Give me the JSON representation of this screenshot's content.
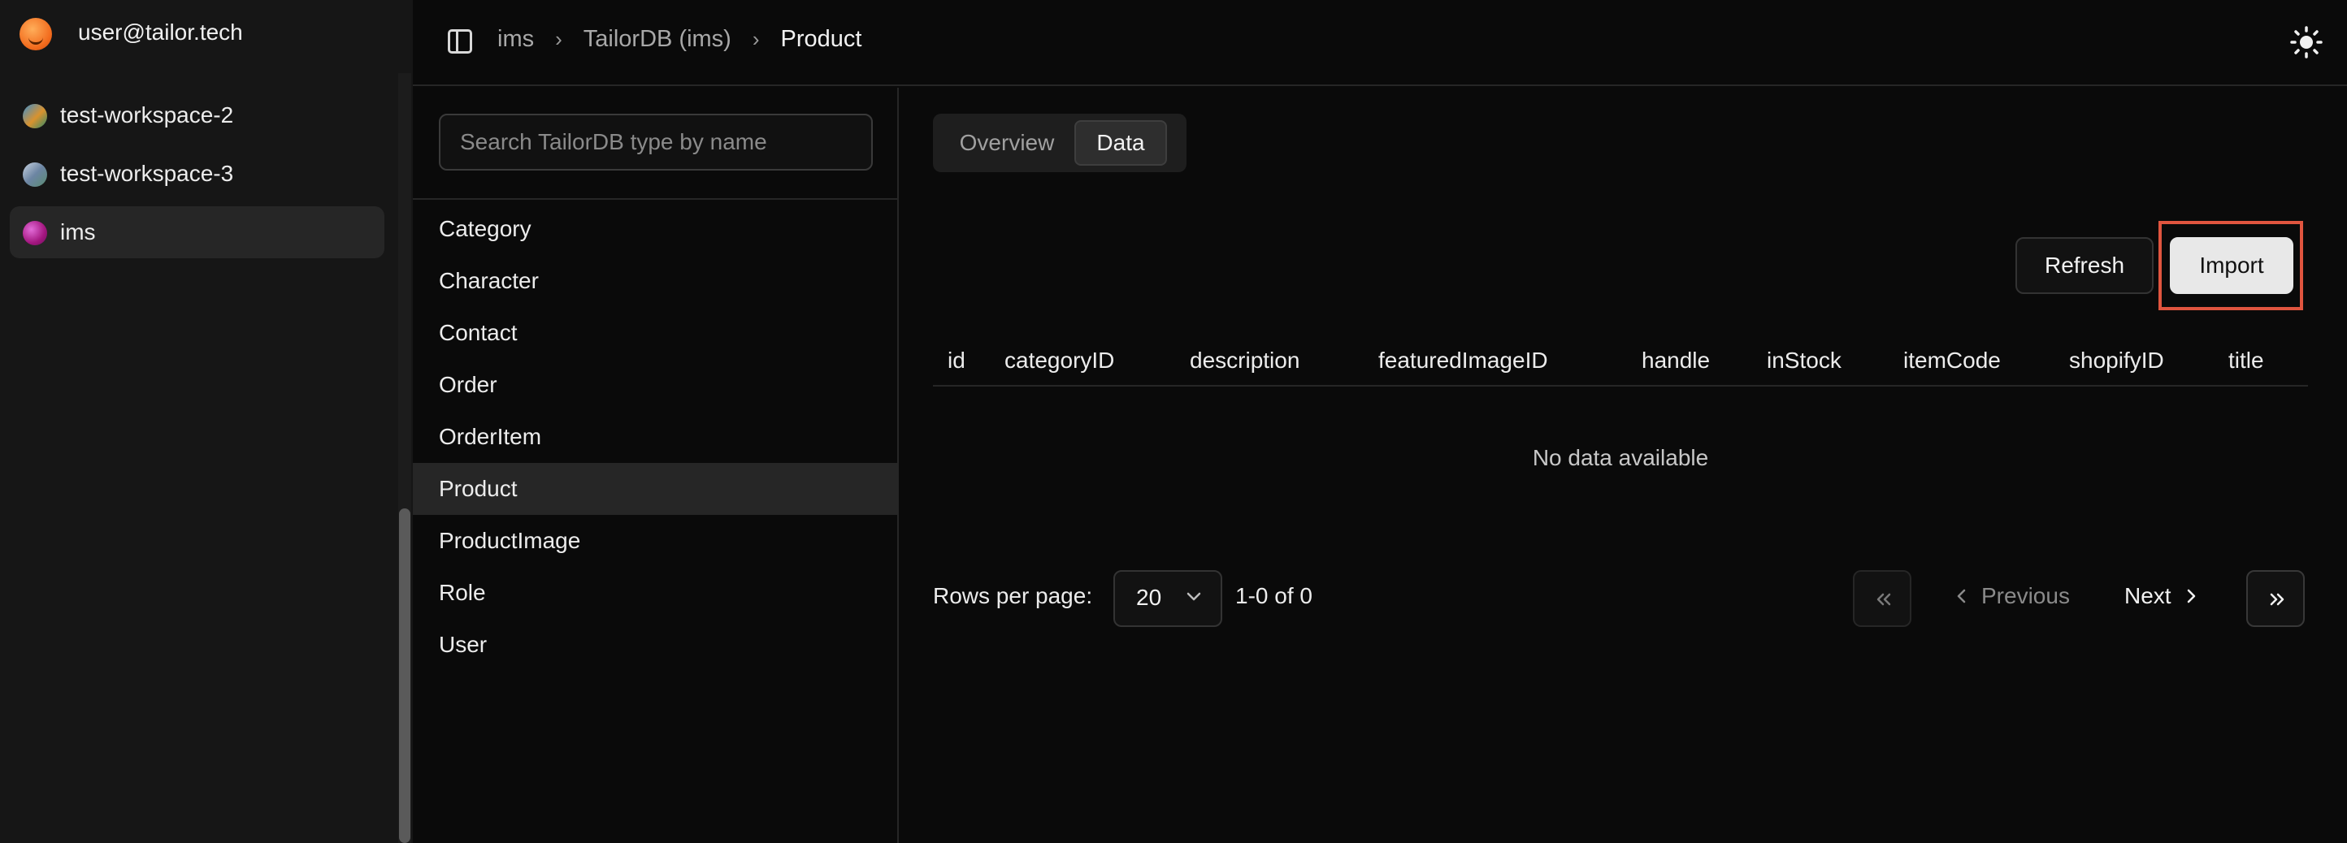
{
  "user": {
    "email": "user@tailor.tech"
  },
  "workspaces": [
    {
      "label": "test-workspace-2",
      "active": false
    },
    {
      "label": "test-workspace-3",
      "active": false
    },
    {
      "label": "ims",
      "active": true
    }
  ],
  "breadcrumb": [
    "ims",
    "TailorDB (ims)",
    "Product"
  ],
  "search": {
    "placeholder": "Search TailorDB type by name",
    "value": ""
  },
  "types": [
    "Category",
    "Character",
    "Contact",
    "Order",
    "OrderItem",
    "Product",
    "ProductImage",
    "Role",
    "User"
  ],
  "selected_type": "Product",
  "tabs": [
    "Overview",
    "Data"
  ],
  "active_tab": "Data",
  "actions": {
    "refresh": "Refresh",
    "import": "Import"
  },
  "table": {
    "columns": [
      "id",
      "categoryID",
      "description",
      "featuredImageID",
      "handle",
      "inStock",
      "itemCode",
      "shopifyID",
      "title"
    ],
    "empty_text": "No data available"
  },
  "pagination": {
    "rows_per_page_label": "Rows per page:",
    "rows_per_page": "20",
    "range": "1-0 of 0",
    "previous": "Previous",
    "next": "Next"
  },
  "icons": {
    "sidebar_toggle": "sidebar-toggle-icon",
    "theme": "sun-icon",
    "breadcrumb_separator": "chevron-right-icon"
  },
  "colors": {
    "highlight": "#e0553f",
    "active_bg": "#262626",
    "background": "#0a0a0a"
  }
}
